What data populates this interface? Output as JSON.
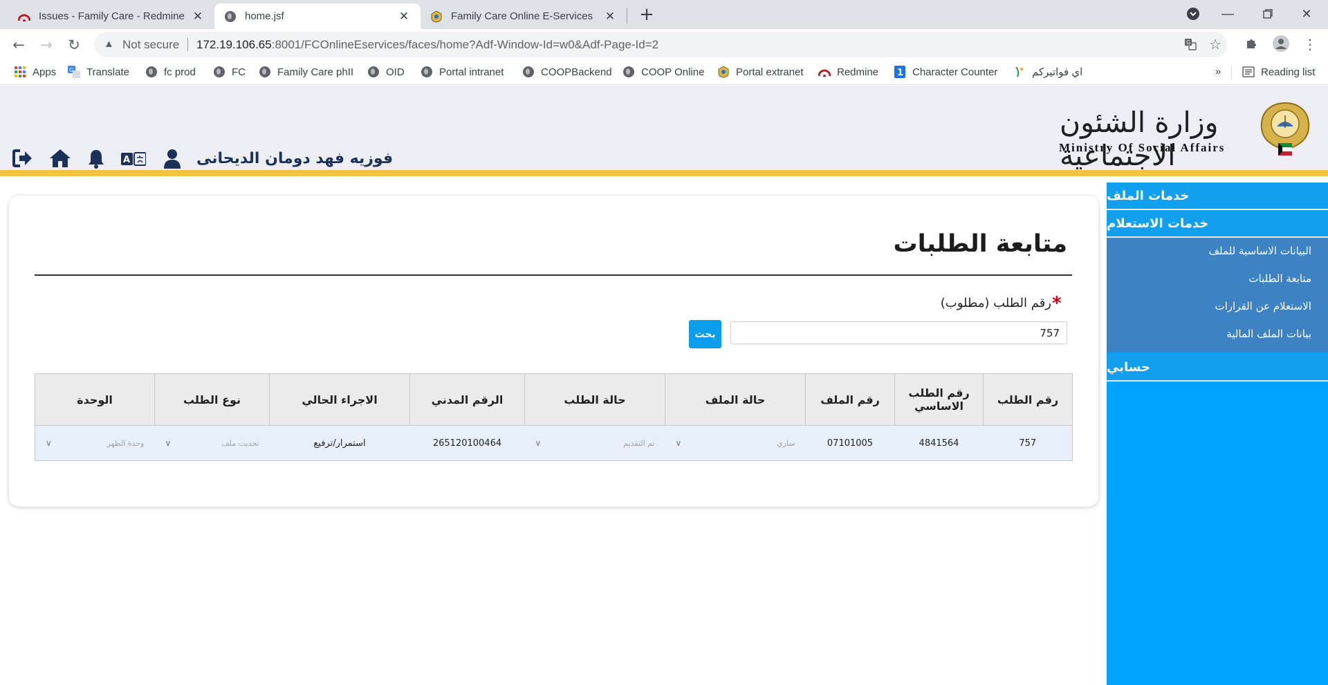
{
  "browser": {
    "tabs": [
      {
        "title": "Issues - Family Care - Redmine",
        "icon": "redmine-icon"
      },
      {
        "title": "home.jsf",
        "icon": "globe-icon"
      },
      {
        "title": "Family Care Online E-Services",
        "icon": "ministry-emblem-icon"
      }
    ],
    "security_label": "Not secure",
    "url_host": "172.19.106.65",
    "url_rest": ":8001/FCOnlineEservices/faces/home?Adf-Window-Id=w0&Adf-Page-Id=2",
    "bookmarks": [
      {
        "label": "Apps",
        "icon": "apps-grid-icon"
      },
      {
        "label": "Translate",
        "icon": "translate-icon"
      },
      {
        "label": "fc prod",
        "icon": "globe-icon"
      },
      {
        "label": "FC",
        "icon": "globe-icon"
      },
      {
        "label": "Family Care phII",
        "icon": "globe-icon"
      },
      {
        "label": "OID",
        "icon": "globe-icon"
      },
      {
        "label": "Portal intranet",
        "icon": "globe-icon"
      },
      {
        "label": "COOPBackend",
        "icon": "globe-icon"
      },
      {
        "label": "COOP Online",
        "icon": "globe-icon"
      },
      {
        "label": "Portal extranet",
        "icon": "ministry-emblem-icon"
      },
      {
        "label": "Redmine",
        "icon": "redmine-icon"
      },
      {
        "label": "Character Counter",
        "icon": "number-one-icon"
      },
      {
        "label": "اي فواتيركم",
        "icon": "invoice-icon"
      }
    ],
    "overflow_label": "»",
    "reading_list_label": "Reading list"
  },
  "header": {
    "logo_arabic": "وزارة الشئون الاجتماعية",
    "logo_english": "Ministry Of Social Affairs",
    "user_name": "فوزيه فهد دومان الديحانى"
  },
  "sidebar": {
    "sections": {
      "file_services": "خدمات الملف",
      "inquiry_services": "خدمات الاستعلام",
      "account": "حسابي"
    },
    "items": [
      "البيانات الاساسية للملف",
      "متابعة الطلبات",
      "الاستعلام عن القرارات",
      "بيانات الملف المالية"
    ]
  },
  "main": {
    "title": "متابعة الطلبات",
    "required_marker": "*",
    "field_label": "رقم الطلب (مطلوب)",
    "search_value": "757",
    "search_button": "بحث",
    "table": {
      "headers": [
        "رقم الطلب",
        "رقم الطلب الاساسي",
        "رقم الملف",
        "حالة الملف",
        "حالة الطلب",
        "الرقم المدني",
        "الاجراء الحالي",
        "نوع الطلب",
        "الوحدة"
      ],
      "row": {
        "request_no": "757",
        "base_request_no": "4841564",
        "file_no": "07101005",
        "file_status": "ساري",
        "request_status": "تم التقديم",
        "civil_id": "265120100464",
        "current_action": "استمرار/ترفيع",
        "request_type": "تحديث ملف",
        "unit": "وحدة الظهر"
      }
    }
  }
}
